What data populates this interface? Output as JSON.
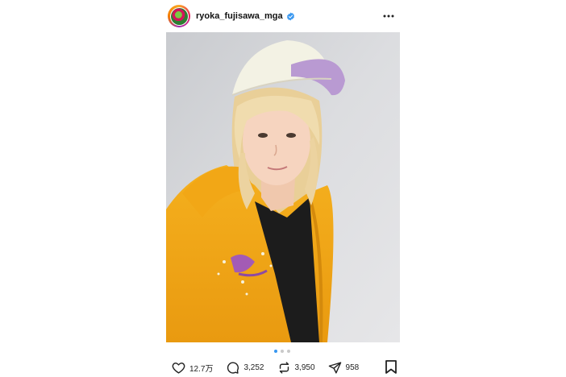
{
  "post": {
    "username": "ryoka_fujisawa_mga",
    "verified": true,
    "accent_color": "#3897f0"
  },
  "carousel": {
    "total_slides": 3,
    "active_slide": 1
  },
  "actions": {
    "likes": "12.7万",
    "replies": "3,252",
    "reposts": "3,950",
    "shares": "958"
  },
  "icons": {
    "more": "more-icon",
    "like": "heart-icon",
    "reply": "comment-icon",
    "repost": "repost-icon",
    "share": "share-icon",
    "save": "bookmark-icon"
  }
}
